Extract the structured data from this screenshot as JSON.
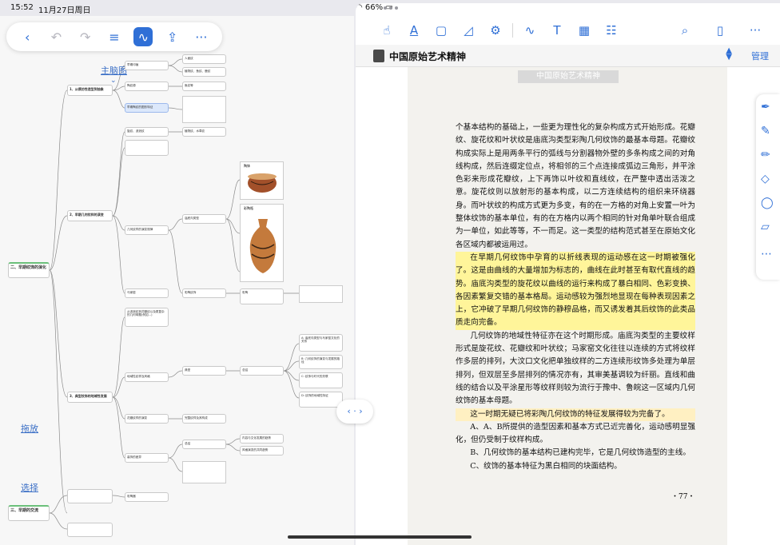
{
  "status": {
    "time": "15:52",
    "date": "11月27日周日",
    "battery": "66%"
  },
  "mindmap": {
    "toolbar": {
      "back": "‹",
      "undo": "↶",
      "redo": "↷",
      "outline": "≡",
      "pen": "∿",
      "share": "⇪",
      "more": "···"
    },
    "link_top": "主脑图",
    "btn_drag": "拖放",
    "btn_select": "选择",
    "nodes": {
      "main": "二、早期纹饰的演化",
      "b1": "1、从模仿性造型到抽象",
      "b2": "2、早期几何纹样的演变",
      "b3": "3、典型纹饰的地域性发展",
      "c1": "早期印痕",
      "c2": "陶纹源",
      "c3": "早期陶纹的图形特征",
      "c4": "旋纹、波浪纹",
      "c5": "几何纹样的演变规律",
      "c6": "马家窑",
      "c7": "从波浪纹到花瓣纹以及更复杂的几何母题(例如…)",
      "c8": "地域性纹样及风格",
      "c9": "花瓣纹样的演变",
      "c10": "装饰的差异",
      "d1": "人面纹",
      "d2": "植物纹、鱼纹、鹿纹",
      "d3": "鱼纹等",
      "d4": "植物纹、水草纹",
      "d5": "庙底沟类型",
      "d6": "彩陶纹饰",
      "d7": "完整纹样及其构成",
      "d8": "典型",
      "d9": "总结",
      "d10": "内容与文化发展的趋势",
      "d11": "风格演变的共同趋势",
      "e1": "陶钵",
      "e2": "彩陶瓶",
      "e3": "彩陶",
      "last": "三、早期的交流",
      "f1": "彩陶器",
      "g1": "A: 庙底沟类型与马家窑文化的关系",
      "g2": "B: 几何纹饰的演变与发展的路径",
      "g3": "C: 纹饰与时代的关联",
      "g4": "D: 纹饰的地域性特征"
    }
  },
  "reader": {
    "title": "中国原始艺术精神",
    "manage": "管理",
    "banner": "中国原始艺术精神",
    "paragraphs": [
      "个基本结构的基础上，一些更为理性化的复杂构成方式开始形成。花瓣纹、旋花纹和叶状纹是庙底沟类型彩陶几何纹饰的最基本母题。花瓣纹构成实际上是用两条平行的弧线与分割器物外壁的多条构成之间的对角线构成，然后连缀定位点，将相邻的三个点连接成弧边三角形，并平涂色彩来形成花瓣纹，上下再饰以叶纹和直线纹，在严整中透出活泼之意。旋花纹则以放射形的基本构成，以二方连续结构的组织来环绕器身。而叶状纹的构成方式更为多变，有的在一方格的对角上安置一叶为整体纹饰的基本单位，有的在方格内以两个相同的针对角单叶联合组成为一单位，如此等等，不一而足。这一类型的结构范式甚至在原始文化各区域内都被运用过。",
      "在早期几何纹饰中孕育的以折线表现的运动感在这一时期被强化了。这是由曲线的大量增加为标志的，曲线在此时甚至有取代直线的趋势。庙底沟类型的旋花纹以曲线的运行来构成了暴白相同、色彩变换、各因素繁复交错的基本格局。运动感较为强烈地显现在每种表现因素之上，它冲破了早期几何纹饰的静穆品格，而又诱发着其后纹饰的此类品质走向完备。",
      "几何纹饰的地域性特征亦在这个时期形成。庙底沟类型的主要纹样形式是旋花纹、花瓣纹和叶状纹；马家窑文化往往以连续的方式将纹样作多层的排列，大汶口文化把单独纹样的二方连续形纹饰多处理为单层排列，但双层至多层排列的情况亦有，其审美基调较为纤丽。直线和曲线的结合以及平涂星形等纹样则较为流行于豫中、鲁皖这一区域内几何纹饰的基本母题。",
      "这一时期无疑已将彩陶几何纹饰的特征发展得较为完备了。",
      "A、A、B所提供的造型因素和基本方式已近完善化，运动感明显强化，但仍受制于纹样构成。",
      "B、几何纹饰的基本结构已建构完毕，它是几何纹饰造型的主线。",
      "C、纹饰的基本特征为黑白相同的块面结构。"
    ],
    "page_number": "・77・",
    "splitter": "‹ · ›"
  }
}
